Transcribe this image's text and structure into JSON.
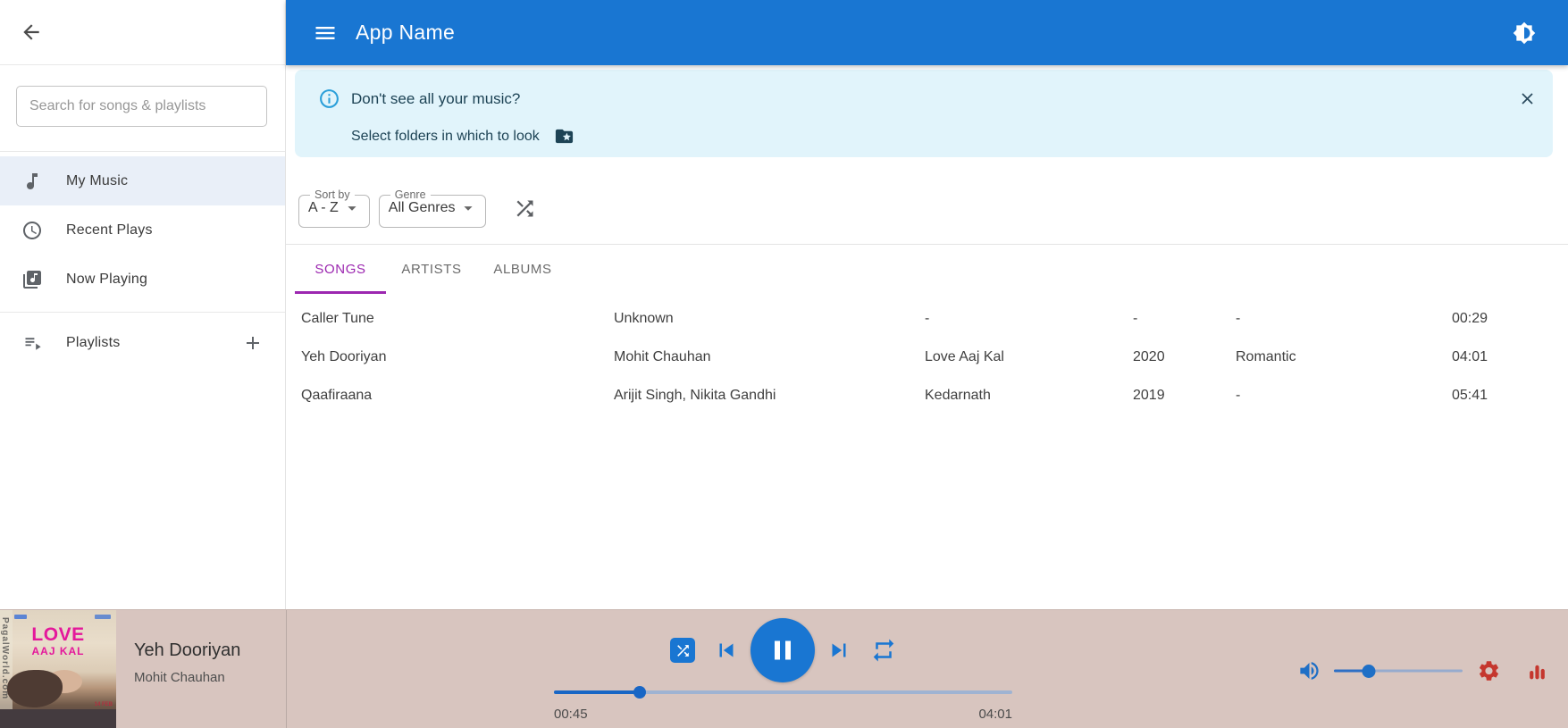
{
  "header": {
    "title": "App Name"
  },
  "sidebar": {
    "search_placeholder": "Search for songs & playlists",
    "items": [
      {
        "label": "My Music",
        "selected": true
      },
      {
        "label": "Recent Plays",
        "selected": false
      },
      {
        "label": "Now Playing",
        "selected": false
      }
    ],
    "playlists_label": "Playlists"
  },
  "banner": {
    "title": "Don't see all your music?",
    "action": "Select folders in which to look"
  },
  "toolbar": {
    "sort_label": "Sort by",
    "sort_value": "A - Z",
    "genre_label": "Genre",
    "genre_value": "All Genres"
  },
  "tabs": [
    {
      "label": "SONGS",
      "active": true
    },
    {
      "label": "ARTISTS",
      "active": false
    },
    {
      "label": "ALBUMS",
      "active": false
    }
  ],
  "songs": [
    {
      "title": "Caller Tune",
      "artist": "Unknown",
      "album": "-",
      "year": "-",
      "genre": "-",
      "duration": "00:29"
    },
    {
      "title": "Yeh Dooriyan",
      "artist": "Mohit Chauhan",
      "album": "Love Aaj Kal",
      "year": "2020",
      "genre": "Romantic",
      "duration": "04:01"
    },
    {
      "title": "Qaafiraana",
      "artist": "Arijit Singh, Nikita Gandhi",
      "album": "Kedarnath",
      "year": "2019",
      "genre": "-",
      "duration": "05:41"
    }
  ],
  "player": {
    "track_title": "Yeh Dooriyan",
    "track_artist": "Mohit Chauhan",
    "elapsed": "00:45",
    "total": "04:01",
    "progress_pct": 18.7,
    "volume_pct": 27,
    "album_art": {
      "line1": "LOVE",
      "line2": "AAJ KAL",
      "watermark": "PagalWorld.com",
      "caption": "14 FEB"
    }
  },
  "colors": {
    "header_blue": "#1976D2",
    "accent_blue": "#1976D2",
    "tab_purple": "#9C27B0",
    "banner_bg": "#E1F4FB",
    "banner_text": "#1D4355",
    "info_icon_blue": "#2B9FD9",
    "player_bar_bg": "#D8C5BF",
    "danger_red": "#C5372E",
    "selected_item_bg": "#E9EFF8"
  }
}
